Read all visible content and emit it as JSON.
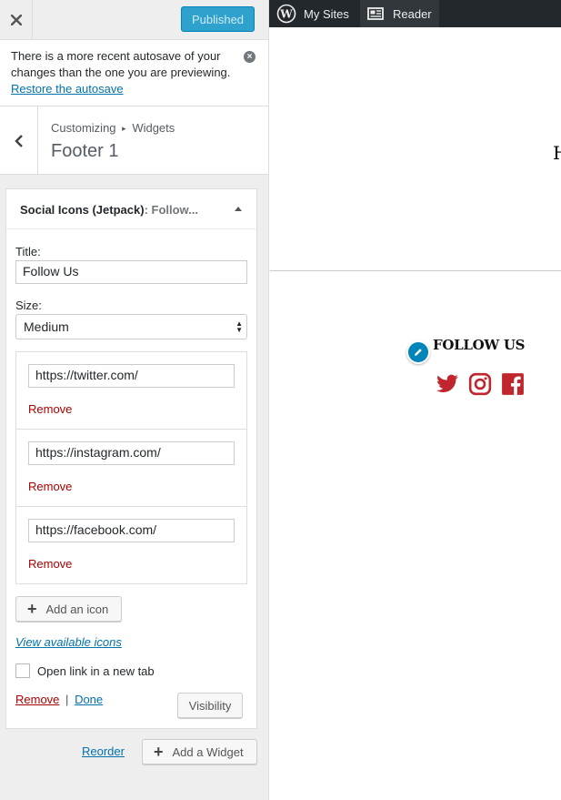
{
  "topbar": {
    "close_label": "Close",
    "publish_label": "Published"
  },
  "notice": {
    "text": "There is a more recent autosave of your changes than the one you are previewing.",
    "link": "Restore the autosave"
  },
  "section": {
    "breadcrumb_root": "Customizing",
    "breadcrumb_sep": "▸",
    "breadcrumb_leaf": "Widgets",
    "title": "Footer 1"
  },
  "widget": {
    "name": "Social Icons (Jetpack)",
    "in_widget_title": ": Follow..."
  },
  "form": {
    "title_label": "Title:",
    "title_value": "Follow Us",
    "size_label": "Size:",
    "size_value": "Medium",
    "icons": [
      {
        "url": "https://twitter.com/",
        "remove_label": "Remove"
      },
      {
        "url": "https://instagram.com/",
        "remove_label": "Remove"
      },
      {
        "url": "https://facebook.com/",
        "remove_label": "Remove"
      }
    ],
    "add_icon_label": "Add an icon",
    "view_icons_label": "View available icons",
    "new_tab_label": "Open link in a new tab",
    "new_tab_checked": false,
    "remove_label": "Remove",
    "pipe": "|",
    "done_label": "Done",
    "visibility_label": "Visibility"
  },
  "footer_actions": {
    "reorder_label": "Reorder",
    "add_widget_label": "Add a Widget"
  },
  "adminbar": {
    "my_sites_label": "My Sites",
    "reader_label": "Reader"
  },
  "preview": {
    "header_letter": "H",
    "follow_title": "FOLLOW US",
    "social_icons": [
      "twitter-icon",
      "instagram-icon",
      "facebook-icon"
    ],
    "accent_color": "#c0262d"
  },
  "colors": {
    "primary": "#0085ba",
    "remove": "#aa0000",
    "social": "#c0262d"
  }
}
